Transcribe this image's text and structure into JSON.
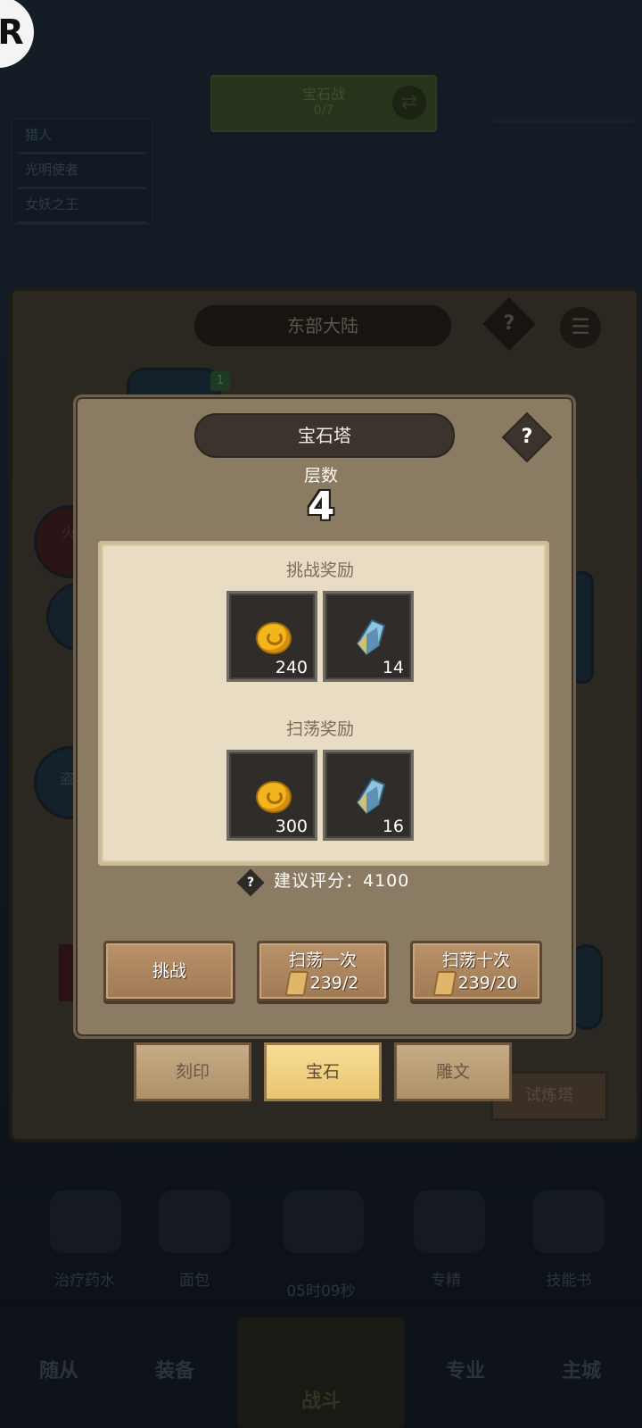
{
  "background": {
    "top_banner": {
      "line1": "宝石战",
      "line2": "0/7"
    },
    "team_list": [
      "猎人",
      "光明使者",
      "女妖之王"
    ],
    "world_title": "东部大陆",
    "world_help": "?",
    "nodes": [
      {
        "label": "火"
      },
      {
        "label": "盗"
      }
    ],
    "node_badge": "1",
    "trial_tower": "试炼塔",
    "bottom_items": [
      "治疗药水",
      "面包",
      "05时09秒",
      "专精",
      "技能书"
    ],
    "bottom_nav": [
      "随从",
      "装备",
      "战斗",
      "专业",
      "主城"
    ]
  },
  "modal": {
    "title": "宝石塔",
    "help": "?",
    "floor_label": "层数",
    "floor_value": "4",
    "challenge_title": "挑战奖励",
    "challenge_rewards": [
      {
        "icon": "coin-icon",
        "count": "240"
      },
      {
        "icon": "crystal-icon",
        "count": "14"
      }
    ],
    "sweep_title": "扫荡奖励",
    "sweep_rewards": [
      {
        "icon": "coin-icon",
        "count": "300"
      },
      {
        "icon": "crystal-icon",
        "count": "16"
      }
    ],
    "recommend_help": "?",
    "recommend_text": "建议评分：4100",
    "buttons": {
      "challenge": "挑战",
      "sweep_once": "扫荡一次",
      "sweep_once_cost": "239/2",
      "sweep_ten": "扫荡十次",
      "sweep_ten_cost": "239/20"
    }
  },
  "tabs": [
    "刻印",
    "宝石",
    "雕文"
  ],
  "active_tab": "宝石",
  "colors": {
    "modal_bg": "#8c7b63",
    "parchment": "#e8dcc2",
    "active_tab": "#f3d488",
    "overlay": "#101820"
  }
}
